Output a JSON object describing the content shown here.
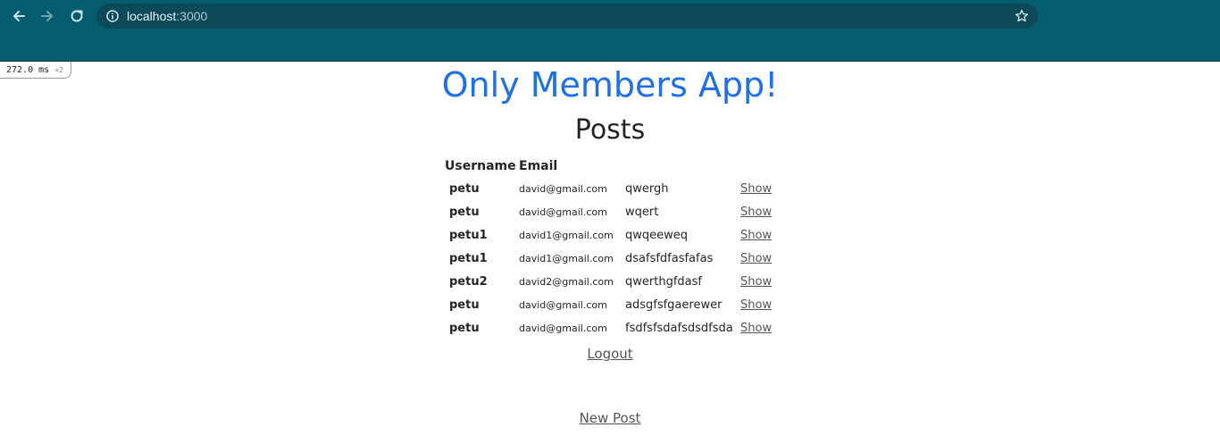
{
  "browser": {
    "url_host": "localhost",
    "url_port": ":3000",
    "icons": [
      "back-arrow-icon",
      "forward-arrow-icon",
      "reload-icon",
      "info-icon",
      "star-icon"
    ]
  },
  "timing": {
    "value": "272.0",
    "unit": "ms",
    "multiplier": "×2"
  },
  "page": {
    "app_title": "Only Members App!",
    "section_title": "Posts",
    "columns": [
      "Username",
      "Email"
    ],
    "show_label": "Show",
    "posts": [
      {
        "username": "petu",
        "email": "david@gmail.com",
        "message": "qwergh"
      },
      {
        "username": "petu",
        "email": "david@gmail.com",
        "message": "wqert"
      },
      {
        "username": "petu1",
        "email": "david1@gmail.com",
        "message": "qwqeeweq"
      },
      {
        "username": "petu1",
        "email": "david1@gmail.com",
        "message": "dsafsfdfasfafas"
      },
      {
        "username": "petu2",
        "email": "david2@gmail.com",
        "message": "qwerthgfdasf"
      },
      {
        "username": "petu",
        "email": "david@gmail.com",
        "message": "adsgfsfgaerewer"
      },
      {
        "username": "petu",
        "email": "david@gmail.com",
        "message": "fsdfsfsdafsdsdfsda"
      }
    ],
    "logout_label": "Logout",
    "new_post_label": "New Post"
  },
  "colors": {
    "chrome": "#045c6e",
    "omnibox": "#0c4a59",
    "title": "#1f6fe5",
    "link": "#555555"
  }
}
